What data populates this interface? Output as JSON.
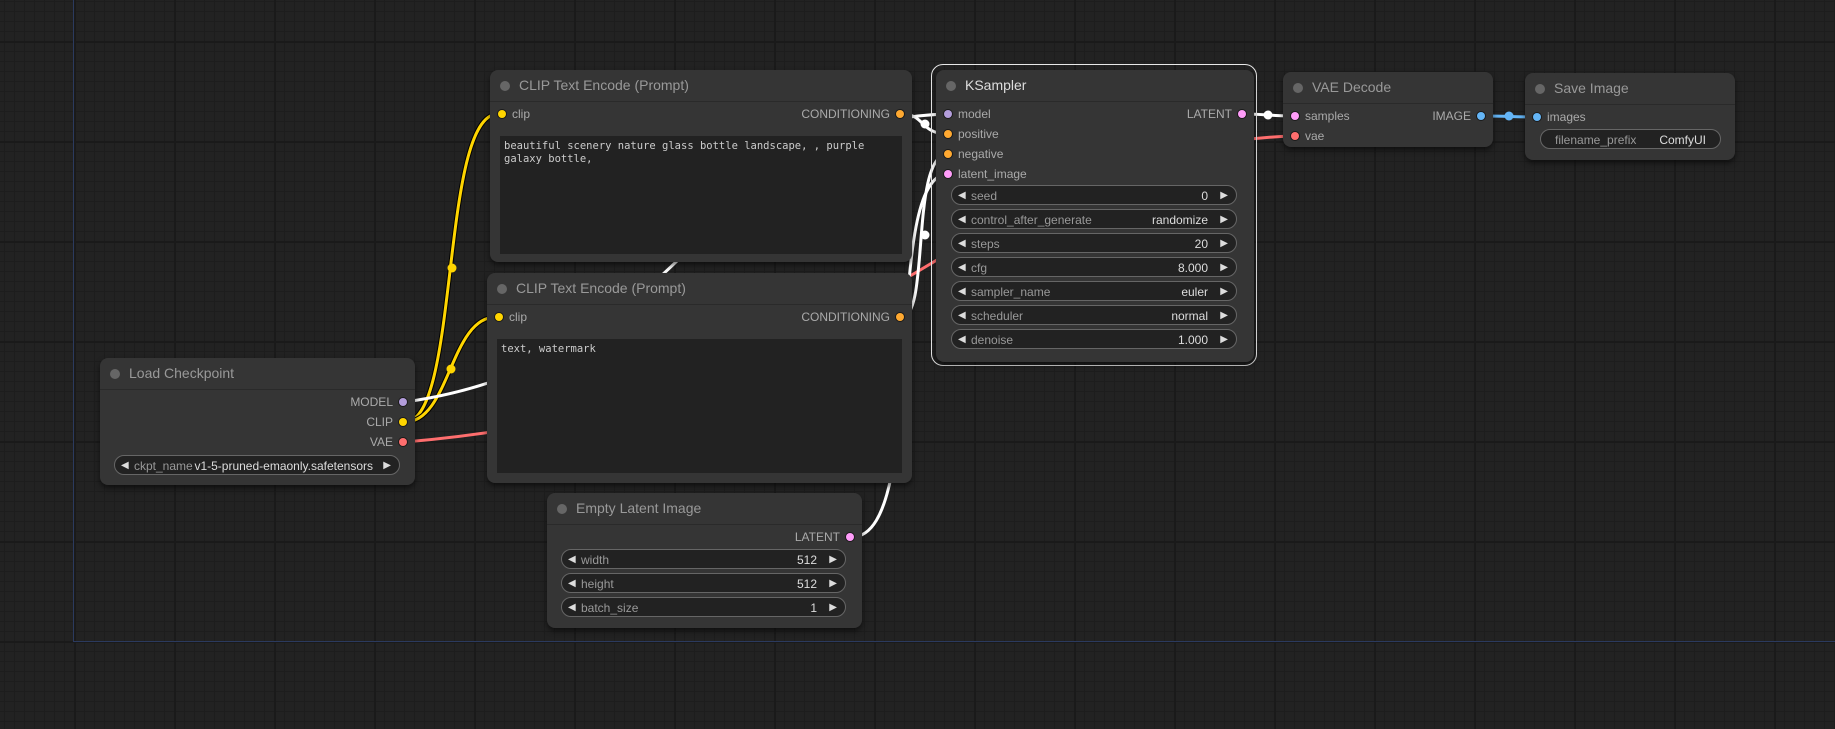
{
  "canvas": {
    "background": "#222222",
    "bounds_color": "#2b3a5e"
  },
  "slot_colors": {
    "MODEL": "#b39ddb",
    "CLIP": "#ffd500",
    "VAE": "#ff6e6e",
    "CONDITIONING": "#ffa931",
    "LATENT": "#ff9cf9",
    "IMAGE": "#64b5f6"
  },
  "nodes": {
    "load_checkpoint": {
      "title": "Load Checkpoint",
      "outputs": [
        "MODEL",
        "CLIP",
        "VAE"
      ],
      "widgets": [
        {
          "label": "ckpt_name",
          "value": "v1-5-pruned-emaonly.safetensors"
        }
      ]
    },
    "clip_positive": {
      "title": "CLIP Text Encode (Prompt)",
      "inputs": [
        "clip"
      ],
      "outputs": [
        "CONDITIONING"
      ],
      "text": "beautiful scenery nature glass bottle landscape, , purple galaxy bottle,"
    },
    "clip_negative": {
      "title": "CLIP Text Encode (Prompt)",
      "inputs": [
        "clip"
      ],
      "outputs": [
        "CONDITIONING"
      ],
      "text": "text, watermark"
    },
    "empty_latent": {
      "title": "Empty Latent Image",
      "outputs": [
        "LATENT"
      ],
      "widgets": [
        {
          "label": "width",
          "value": "512"
        },
        {
          "label": "height",
          "value": "512"
        },
        {
          "label": "batch_size",
          "value": "1"
        }
      ]
    },
    "ksampler": {
      "title": "KSampler",
      "inputs": [
        "model",
        "positive",
        "negative",
        "latent_image"
      ],
      "outputs": [
        "LATENT"
      ],
      "widgets": [
        {
          "label": "seed",
          "value": "0"
        },
        {
          "label": "control_after_generate",
          "value": "randomize"
        },
        {
          "label": "steps",
          "value": "20"
        },
        {
          "label": "cfg",
          "value": "8.000"
        },
        {
          "label": "sampler_name",
          "value": "euler"
        },
        {
          "label": "scheduler",
          "value": "normal"
        },
        {
          "label": "denoise",
          "value": "1.000"
        }
      ]
    },
    "vae_decode": {
      "title": "VAE Decode",
      "inputs": [
        "samples",
        "vae"
      ],
      "outputs": [
        "IMAGE"
      ]
    },
    "save_image": {
      "title": "Save Image",
      "inputs": [
        "images"
      ],
      "widgets": [
        {
          "label": "filename_prefix",
          "value": "ComfyUI"
        }
      ]
    }
  },
  "icons": {
    "arrow_left": "◀",
    "arrow_right": "▶"
  }
}
